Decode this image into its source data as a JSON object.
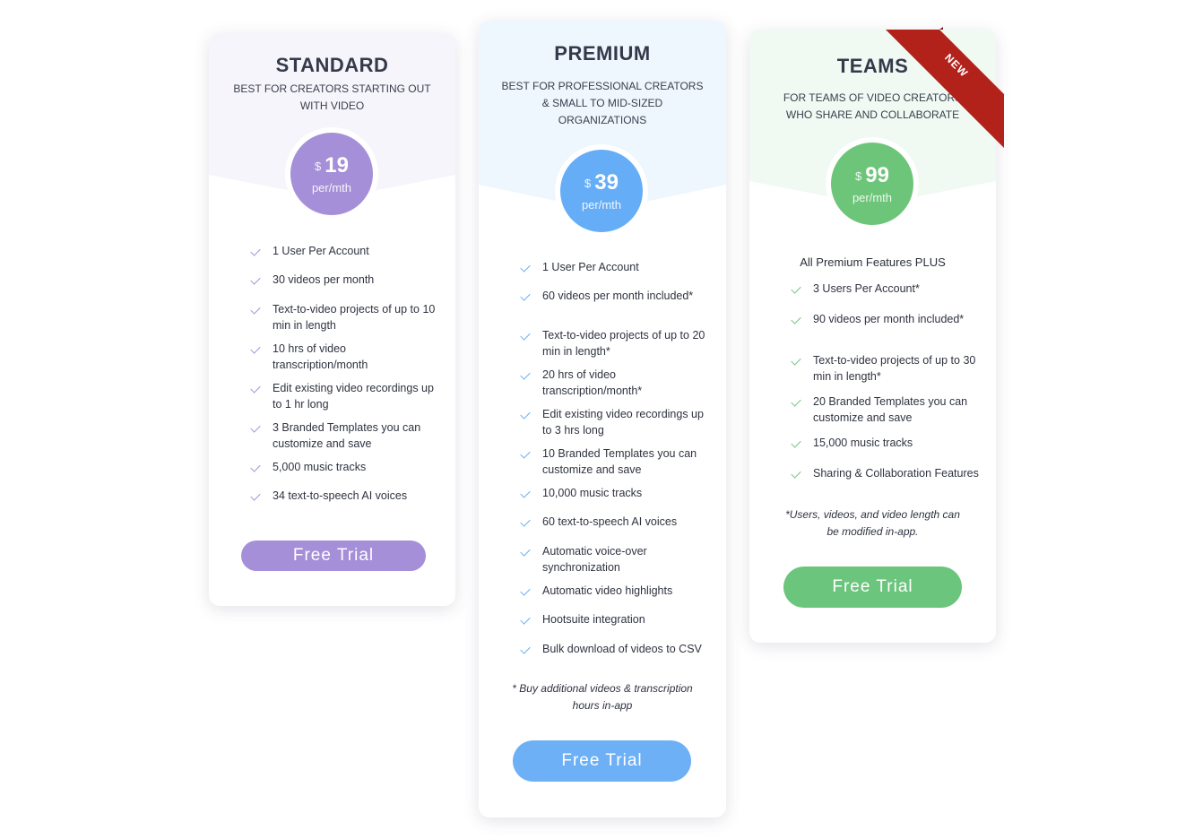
{
  "plans": [
    {
      "name": "STANDARD",
      "subtitle": "BEST FOR CREATORS STARTING OUT WITH VIDEO",
      "currency": "$",
      "price": "19",
      "period": "per/mth",
      "accent": "#a58fd8",
      "features": [
        "1 User Per Account",
        "30 videos per month",
        "Text-to-video projects of up to 10 min in length",
        "10 hrs of video transcription/month",
        "Edit existing video recordings up to 1 hr long",
        "3 Branded Templates you can customize and save",
        "5,000 music tracks",
        "34 text-to-speech AI voices"
      ],
      "button": "Free Trial"
    },
    {
      "name": "PREMIUM",
      "subtitle": "BEST FOR PROFESSIONAL CREATORS & SMALL TO MID-SIZED ORGANIZATIONS",
      "currency": "$",
      "price": "39",
      "period": "per/mth",
      "accent": "#66adf7",
      "features": [
        "1 User Per Account",
        "60 videos per month included*",
        "Text-to-video projects of up to 20 min in length*",
        "20 hrs of video transcription/month*",
        "Edit existing video recordings up to 3 hrs long",
        "10 Branded Templates you can customize and save",
        "10,000 music tracks",
        "60 text-to-speech AI voices",
        "Automatic voice-over synchronization",
        "Automatic video highlights",
        "Hootsuite integration",
        "Bulk download of videos to CSV"
      ],
      "note": "* Buy additional videos & transcription hours in-app",
      "button": "Free Trial"
    },
    {
      "name": "TEAMS",
      "subtitle": "FOR TEAMS OF VIDEO CREATORS WHO SHARE AND COLLABORATE",
      "ribbon": "NEW",
      "currency": "$",
      "price": "99",
      "period": "per/mth",
      "accent": "#6dc57a",
      "intro": "All Premium Features PLUS",
      "features": [
        "3 Users Per Account*",
        "90 videos per month included*",
        "Text-to-video projects of up to 30 min in length*",
        "20 Branded Templates you can customize and save",
        "15,000 music tracks",
        "Sharing & Collaboration Features"
      ],
      "note": "*Users, videos, and video length can be modified in-app.",
      "button": "Free Trial"
    }
  ],
  "ribbon_color": "#b3211b"
}
